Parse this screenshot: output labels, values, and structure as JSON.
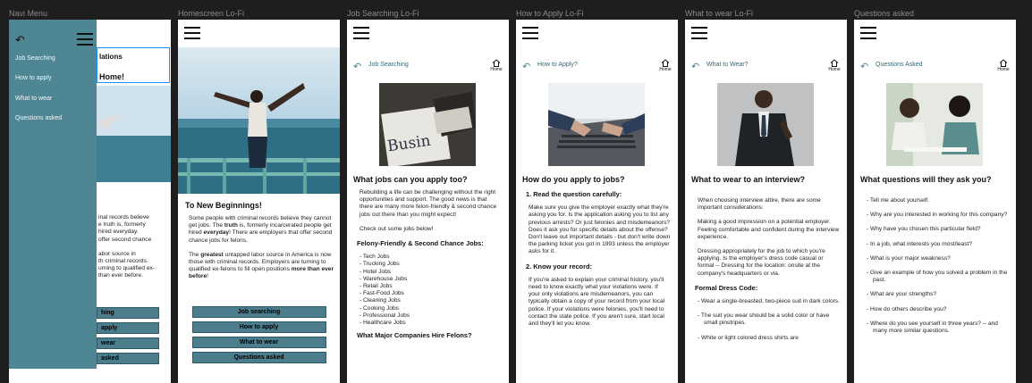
{
  "frames": {
    "navi": {
      "label": "Navi Menu",
      "menu": [
        "Job Searching",
        "How to apply",
        "What to wear",
        "Questions asked"
      ],
      "behind": {
        "title_lines": [
          "lations",
          "Home!"
        ],
        "text_lines": [
          "inal records believe",
          "e truth is, formerly",
          "hired everyday.",
          "offer second chance",
          "",
          "abor source in",
          "th criminal records.",
          "urning to qualified ex-",
          "than ever before."
        ],
        "buttons": [
          "hing",
          "apply",
          "wear",
          "asked"
        ]
      }
    },
    "home": {
      "label": "Homescreen Lo-Fi",
      "heading": "To New Beginnings!",
      "p1": {
        "a": "Some people with criminal records believe they cannot get jobs. The ",
        "b": "truth",
        "c": " is, formerly incarcerated people get hired ",
        "d": "everyday",
        "e": "! There are employers that offer second chance jobs for felons."
      },
      "p2": {
        "a": "The ",
        "b": "greatest",
        "c": " untapped labor source in America is now those with criminal records. Employers are turning to qualified ex-felons to fill open positions ",
        "d": "more than ever before",
        "e": "!"
      },
      "buttons": [
        "Job searching",
        "How to apply",
        "What to wear",
        "Questions asked"
      ]
    },
    "job": {
      "label": "Job Searching Lo-Fi",
      "subhead": "Job Searching",
      "home": "Home",
      "heading": "What jobs can you apply too?",
      "p1": "Rebuilding a life can be challenging without the right opportunities and support. The good news is that there are many more felon-friendly & second chance jobs out there than you might expect!",
      "p2": "Check out some jobs below!",
      "sub1": "Felony-Friendly & Second Chance Jobs:",
      "jobs": [
        "Tech Jobs",
        "Trucking Jobs",
        "Hotel Jobs",
        "Warehouse Jobs",
        "Retail Jobs",
        "Fast-Food Jobs",
        "Cleaning Jobs",
        "Cooking Jobs",
        "Professional Jobs",
        "Healthcare Jobs"
      ],
      "sub2": "What Major Companies Hire Felons?"
    },
    "apply": {
      "label": "How to Apply Lo-Fi",
      "subhead": "How to Apply?",
      "home": "Home",
      "heading": "How do you apply to jobs?",
      "sub1": "1. Read the question carefully:",
      "p1": "Make sure you give the employer exactly what they're asking you for. Is the application asking you to list any previous arrests? Or just felonies and misdemeanors? Does it ask you for specific details about the offense? Don't leave out important details - but don't write down the parking ticket you got in 1993 unless the employer asks for it.",
      "sub2": "2. Know your record:",
      "p2": "If you're asked to explain your criminal history, you'll need to know exactly what your violations were. If your only violations are misdemeanors, you can typically obtain a copy of your record from your local police. If your violations were felonies, you'll need to contact the state police. If you aren't sure, start local and they'll let you know."
    },
    "wear": {
      "label": "What to wear Lo-Fi",
      "subhead": "What to Wear?",
      "home": "Home",
      "heading": "What to wear to an interview?",
      "p1": "When choosing interview attire, there are some important considerations:",
      "p2": "Making a good impression on a potential employer.",
      "p3": "Feeling comfortable and confident during the interview experience.",
      "p4": "Dressing appropriately for the job to which you're applying. Is the employer's dress code casual or formal -- Dressing for the location: onsite at the company's headquarters or via.",
      "sub1": "Formal Dress Code:",
      "items": [
        "Wear a single-breasted, two-piece suit in dark colors.",
        "The suit you wear should be a solid color or have small pinstripes.",
        "White or light colored dress shirts are"
      ]
    },
    "questions": {
      "label": "Questions asked",
      "subhead": "Questions Asked",
      "home": "Home",
      "heading": "What questions will they ask you?",
      "items": [
        "Tell me about yourself.",
        "Why are you interested in working for this company?",
        "Why have you chosen this particular field?",
        "In a job, what interests you most/least?",
        "What is your major weakness?",
        "Give an example of how you solved a problem in the past.",
        "What are your strengths?",
        "How do others describe you?",
        "Where do you see yourself in three years? -- and many more similar questions."
      ]
    }
  },
  "colors": {
    "teal": "#4f8694",
    "button": "#4b7d8c",
    "background": "#1e1e1e",
    "selection": "#1e90ff"
  }
}
